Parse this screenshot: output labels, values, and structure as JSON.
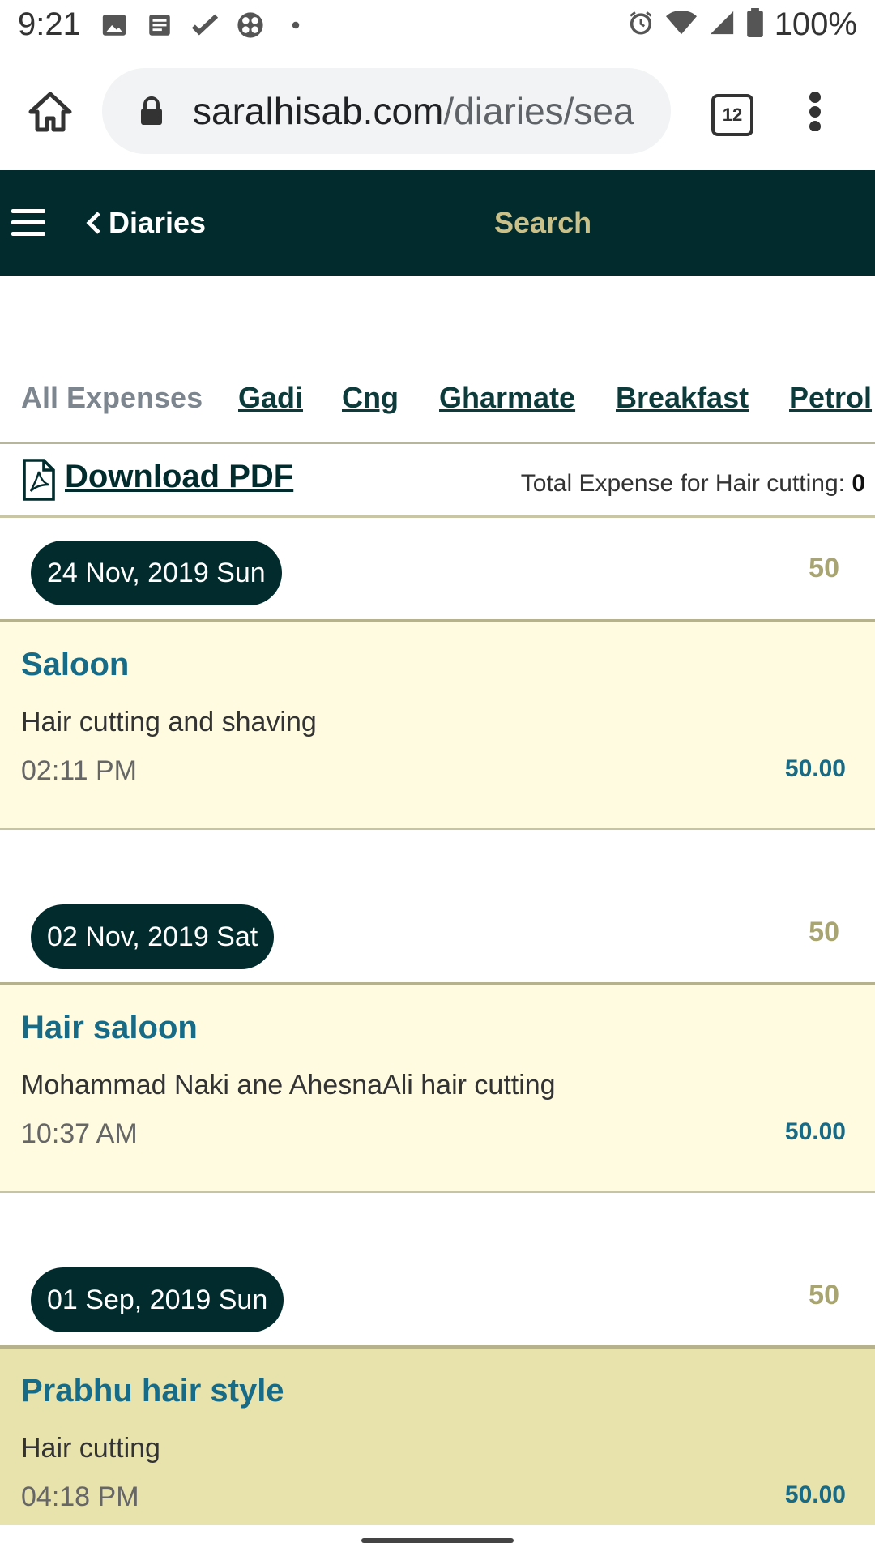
{
  "status": {
    "time": "9:21",
    "battery": "100%",
    "left_icons": [
      "image-icon",
      "news-icon",
      "check-icon",
      "app-icon",
      "dot-icon"
    ],
    "right_icons": [
      "alarm-icon",
      "wifi-icon",
      "signal-icon",
      "battery-icon"
    ]
  },
  "browser": {
    "url_main": "saralhisab.com",
    "url_path": "/diaries/sea",
    "tabs_count": "12"
  },
  "header": {
    "back_label": "Diaries",
    "title": "Search"
  },
  "categories": [
    {
      "label": "All Expenses",
      "active": true
    },
    {
      "label": "Gadi"
    },
    {
      "label": "Cng"
    },
    {
      "label": "Gharmate"
    },
    {
      "label": "Breakfast"
    },
    {
      "label": "Petrol"
    }
  ],
  "download": {
    "label": "Download PDF",
    "total_label": "Total Expense for Hair cutting: ",
    "total_value": "0"
  },
  "groups": [
    {
      "date": "24 Nov, 2019 Sun",
      "total": "50",
      "entry": {
        "title": "Saloon",
        "desc": "Hair cutting and shaving",
        "time": "02:11 PM",
        "amount": "50.00"
      }
    },
    {
      "date": "02 Nov, 2019 Sat",
      "total": "50",
      "entry": {
        "title": "Hair saloon",
        "desc": "Mohammad Naki ane AhesnaAli hair cutting",
        "time": "10:37 AM",
        "amount": "50.00"
      }
    },
    {
      "date": "01 Sep, 2019 Sun",
      "total": "50",
      "entry": {
        "title": "Prabhu hair style",
        "desc": "Hair cutting",
        "time": "04:18 PM",
        "amount": "50.00"
      }
    }
  ]
}
